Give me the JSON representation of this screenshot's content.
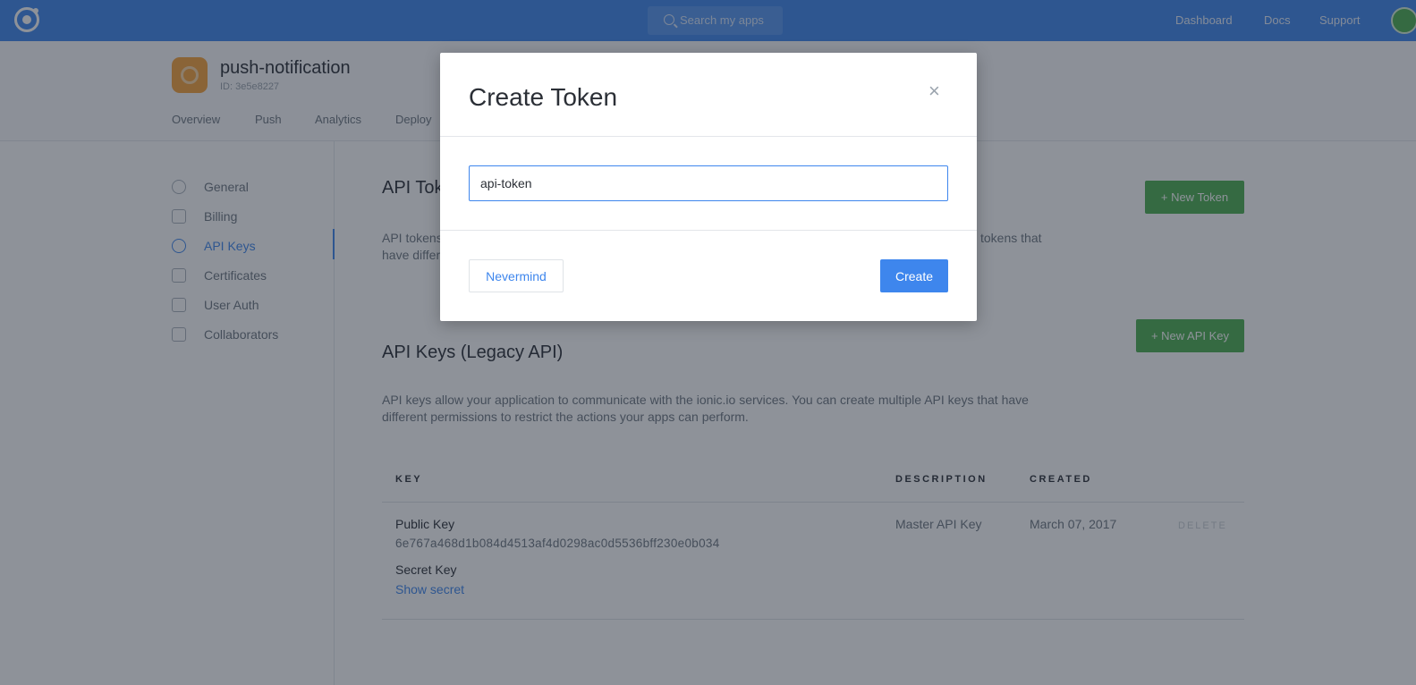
{
  "topbar": {
    "search_placeholder": "Search my apps",
    "nav": [
      "Dashboard",
      "Docs",
      "Support"
    ]
  },
  "app": {
    "name": "push-notification",
    "id_text": "ID: 3e5e8227",
    "tabs": [
      "Overview",
      "Push",
      "Analytics",
      "Deploy"
    ]
  },
  "sidebar": {
    "items": [
      {
        "label": "General",
        "icon": "gear-icon"
      },
      {
        "label": "Billing",
        "icon": "credit-card-icon"
      },
      {
        "label": "API Keys",
        "icon": "key-icon"
      },
      {
        "label": "Certificates",
        "icon": "certificate-icon"
      },
      {
        "label": "User Auth",
        "icon": "user-auth-icon"
      },
      {
        "label": "Collaborators",
        "icon": "collaborators-icon"
      }
    ]
  },
  "api_tokens": {
    "title": "API Tok",
    "desc_left": "API tokens",
    "desc_left2": "have differ",
    "desc_right": "tokens that",
    "new_button": "+ New Token"
  },
  "api_keys": {
    "title": "API Keys (Legacy API)",
    "desc": "API keys allow your application to communicate with the ionic.io services. You can create multiple API keys that have different permissions to restrict the actions your apps can perform.",
    "new_button": "+ New API Key",
    "columns": [
      "KEY",
      "DESCRIPTION",
      "CREATED"
    ],
    "row": {
      "public_label": "Public Key",
      "public_value": "6e767a468d1b084d4513af4d0298ac0d5536bff230e0b034",
      "secret_label": "Secret Key",
      "show_secret": "Show secret",
      "description": "Master API Key",
      "created": "March 07, 2017",
      "delete": "DELETE"
    }
  },
  "modal": {
    "title": "Create Token",
    "close": "×",
    "input_value": "api-token",
    "cancel": "Nevermind",
    "submit": "Create"
  },
  "colors": {
    "accent": "#3e86ed",
    "green": "#4caf50"
  }
}
